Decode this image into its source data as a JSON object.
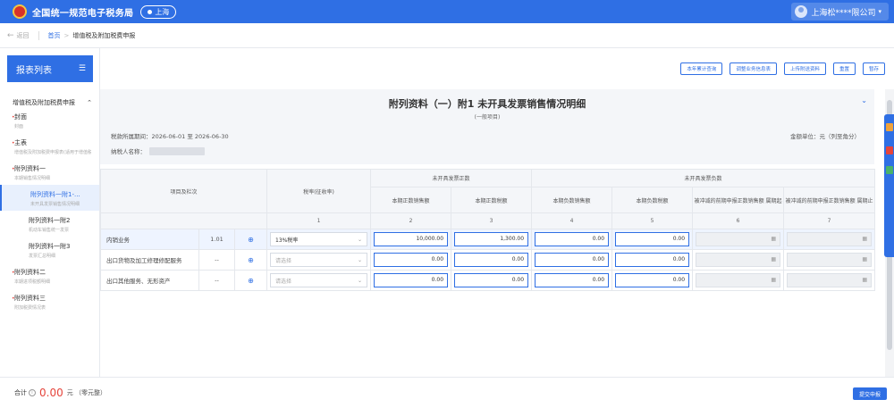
{
  "header": {
    "app_title": "全国统一规范电子税务局",
    "region": "上海",
    "user": "上海松****限公司"
  },
  "breadcrumb": {
    "back": "返回",
    "home": "首页",
    "current": "增值税及附加税费申报"
  },
  "sidebar": {
    "title": "报表列表",
    "group": "增值税及附加税费申报",
    "items": [
      {
        "label": "封面",
        "sub": "封面"
      },
      {
        "label": "主表",
        "sub": "增值税及附加税费申报表(适用于增值税一般纳税人)"
      },
      {
        "label": "附列资料一",
        "sub": "本期销售情况明细"
      },
      {
        "label": "附列资料一附1-...",
        "sub": "未开具发票销售情况明细"
      },
      {
        "label": "附列资料一附2",
        "sub": "机动车销售统一发票"
      },
      {
        "label": "附列资料一附3",
        "sub": "发票汇总明细"
      },
      {
        "label": "附列资料二",
        "sub": "本期进项税额明细"
      },
      {
        "label": "附列资料三",
        "sub": "附加税费情况表"
      }
    ]
  },
  "toolbar": {
    "btn1": "本年累计查询",
    "btn2": "调整业务信息表",
    "btn3": "上传附送资料",
    "btn4": "重置",
    "btn5": "暂存"
  },
  "form": {
    "title": "附列资料（一）附1 未开具发票销售情况明细",
    "subtitle": "(一般项目)",
    "period_label": "税款所属期间：",
    "period_value": "2026-06-01 至 2026-06-30",
    "unit": "金额单位：元（列至角分）",
    "taxpayer_label": "纳税人名称："
  },
  "table": {
    "header": {
      "item": "项目及栏次",
      "rate": "税率(征收率)",
      "group_pos": "未开具发票正数",
      "group_neg": "未开具发票负数",
      "cols": [
        "本期正数销售额",
        "本期正数税额",
        "本期负数销售额",
        "本期负数税额",
        "被冲减的前期申报正数销售额 属期起",
        "被冲减的前期申报正数销售额 属期止"
      ],
      "nums": [
        "1",
        "2",
        "3",
        "4",
        "5",
        "6",
        "7"
      ]
    },
    "rows": [
      {
        "item": "内销业务",
        "code": "1.01",
        "rate": "13%税率",
        "v1": "10,000.00",
        "v2": "1,300.00",
        "v3": "0.00",
        "v4": "0.00"
      },
      {
        "item": "出口货物及加工修理修配服务",
        "code": "--",
        "rate": "请选择",
        "v1": "0.00",
        "v2": "0.00",
        "v3": "0.00",
        "v4": "0.00"
      },
      {
        "item": "出口其他服务、无形资产",
        "code": "--",
        "rate": "请选择",
        "v1": "0.00",
        "v2": "0.00",
        "v3": "0.00",
        "v4": "0.00"
      }
    ]
  },
  "footer": {
    "total_label": "合计",
    "total_value": "0.00",
    "total_unit": "元 （零元整）",
    "submit": "提交申报"
  },
  "colors": {
    "primary": "#2f6fe4",
    "danger": "#e5443b"
  }
}
